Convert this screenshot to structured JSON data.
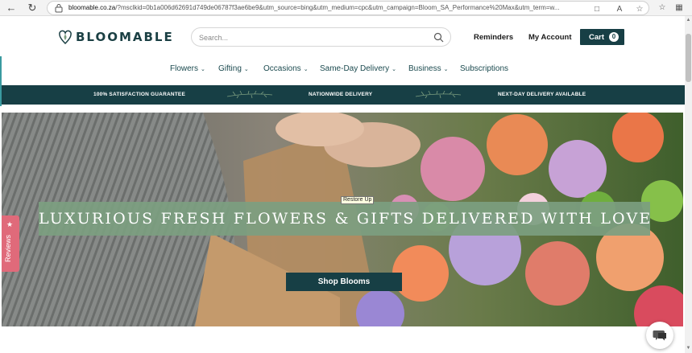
{
  "browser": {
    "url_domain": "bloomable.co.za",
    "url_rest": "/?msclkid=0b1a006d62691d749de06787f3ae6be9&utm_source=bing&utm_medium=cpc&utm_campaign=Bloom_SA_Performance%20Max&utm_term=w...",
    "icons": [
      "back-icon",
      "refresh-icon",
      "lock-icon",
      "tab-icon",
      "reader-icon",
      "favorite-icon",
      "collections-icon"
    ]
  },
  "header": {
    "logo_text": "BLOOMABLE",
    "search_placeholder": "Search...",
    "reminders": "Reminders",
    "my_account": "My Account",
    "cart_label": "Cart",
    "cart_count": "0"
  },
  "menu": {
    "flowers": "Flowers",
    "gifting": "Gifting",
    "occasions": "Occasions",
    "same_day": "Same-Day Delivery",
    "business": "Business",
    "subscriptions": "Subscriptions"
  },
  "banner": {
    "guarantee": "100% SATISFACTION GUARANTEE",
    "nationwide": "NATIONWIDE DELIVERY",
    "next_day": "NEXT-DAY DELIVERY AVAILABLE"
  },
  "hero": {
    "headline": "LUXURIOUS FRESH FLOWERS & GIFTS DELIVERED WITH LOVE",
    "button": "Shop Blooms",
    "tooltip": "Restore Up"
  },
  "reviews": {
    "label": "Reviews"
  },
  "colors": {
    "brand_teal": "#173f45",
    "hero_band": "#7c9e80",
    "reviews_pink": "#e06a7a"
  }
}
